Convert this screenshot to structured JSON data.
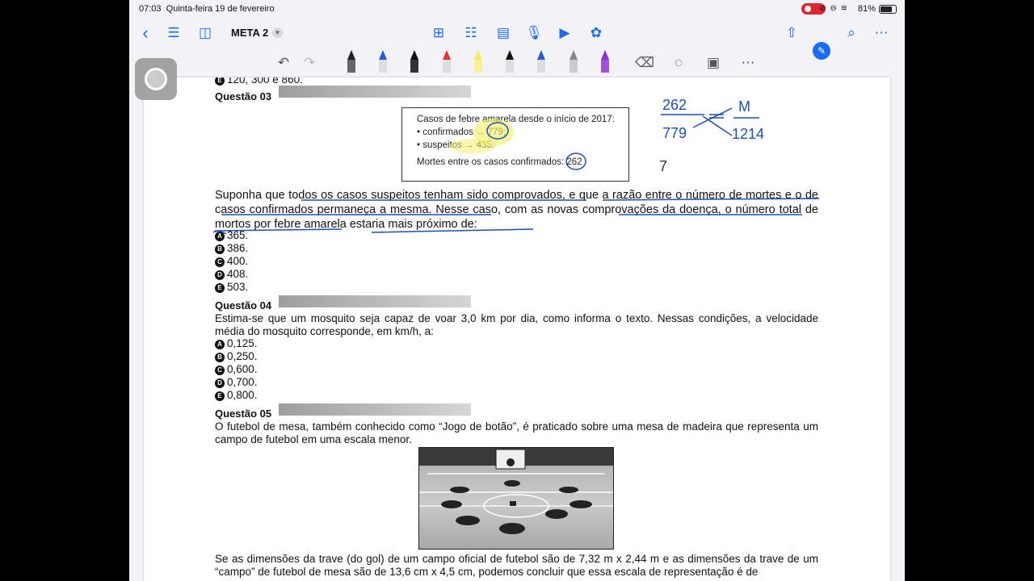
{
  "status": {
    "time": "07:03",
    "date": "Quinta-feira 19 de fevereiro",
    "battery": "81%"
  },
  "nav": {
    "title": "META 2"
  },
  "page": {
    "prev_option": "120, 300 e 860.",
    "q3": {
      "heading": "Questão 03",
      "box_title": "Casos de febre amarela desde o início de 2017:",
      "box_line1": "• confirmados → 779;",
      "box_line2": "• suspeitos → 435.",
      "box_line3": "Mortes entre os casos confirmados: 262",
      "text": "Suponha que todos os casos suspeitos tenham sido comprovados, e que a razão entre o número de mortes e o de casos confirmados permaneça a mesma. Nesse caso, com as novas comprovações da doença, o número total de mortos por febre amarela estaria mais próximo de:",
      "options": [
        {
          "letter": "A",
          "text": "365."
        },
        {
          "letter": "B",
          "text": "386."
        },
        {
          "letter": "C",
          "text": "400."
        },
        {
          "letter": "D",
          "text": "408."
        },
        {
          "letter": "E",
          "text": "503."
        }
      ]
    },
    "q4": {
      "heading": "Questão 04",
      "text": "Estima-se que um mosquito seja capaz de voar 3,0 km por dia, como informa o texto. Nessas condições, a velocidade média do mosquito corresponde, em km/h, a:",
      "options": [
        {
          "letter": "A",
          "text": "0,125."
        },
        {
          "letter": "B",
          "text": "0,250."
        },
        {
          "letter": "C",
          "text": "0,600."
        },
        {
          "letter": "D",
          "text": "0,700."
        },
        {
          "letter": "E",
          "text": "0,800."
        }
      ]
    },
    "q5": {
      "heading": "Questão 05",
      "text": "O futebol de mesa, também conhecido como “Jogo de botão”, é praticado sobre uma mesa de madeira que representa um campo de futebol em uma escala menor.",
      "text2": "Se as dimensões da trave (do gol) de um campo oficial de futebol são de 7,32 m x 2,44 m e as dimensões da trave de um “campo” de futebol de mesa são de 13,6 cm x 4,5 cm, podemos concluir que essa escala de representação é de"
    }
  },
  "handwriting": {
    "n1": "262",
    "n2": "779",
    "n3": "M",
    "n4": "1214",
    "n5": "7"
  }
}
